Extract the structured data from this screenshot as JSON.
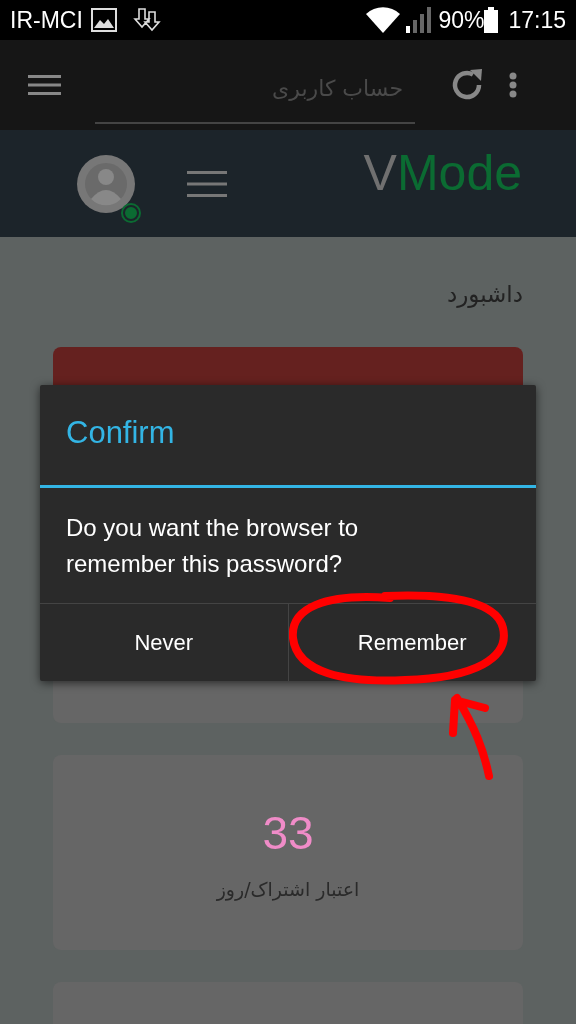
{
  "status_bar": {
    "carrier": "IR-MCI",
    "battery": "90%",
    "time": "17:15"
  },
  "browser_toolbar": {
    "address": "حساب کاربری"
  },
  "site_header": {
    "logo": [
      "V",
      "Mode"
    ],
    "online": true
  },
  "page": {
    "title": "داشبورد",
    "cards": [
      {
        "kind": "alert"
      },
      {
        "kind": "stat",
        "value": "33",
        "label": "اعتبار اشتراک/روز"
      },
      {
        "kind": "blank"
      }
    ]
  },
  "dialog": {
    "title": "Confirm",
    "message": "Do you want the browser to remember this password?",
    "buttons": [
      {
        "label": "Never"
      },
      {
        "label": "Remember"
      }
    ]
  }
}
